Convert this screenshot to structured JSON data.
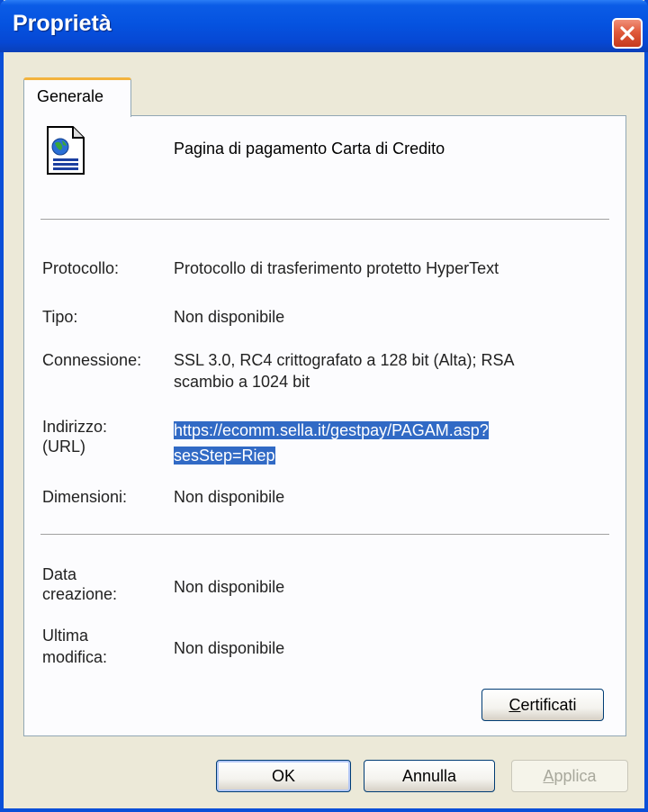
{
  "window": {
    "title": "Proprietà"
  },
  "tabs": [
    {
      "label": "Generale"
    }
  ],
  "page": {
    "title": "Pagina di pagamento Carta di Credito"
  },
  "properties": {
    "protocollo": {
      "label": "Protocollo:",
      "value": "Protocollo di trasferimento protetto HyperText"
    },
    "tipo": {
      "label": "Tipo:",
      "value": "Non disponibile"
    },
    "connessione": {
      "label": "Connessione:",
      "value_line1": "SSL 3.0, RC4 crittografato a 128 bit (Alta); RSA",
      "value_line2": "scambio a 1024 bit"
    },
    "indirizzo": {
      "label_line1": "Indirizzo:",
      "label_line2": "(URL)",
      "value_line1": "https://ecomm.sella.it/gestpay/PAGAM.asp?",
      "value_line2": "sesStep=Riep"
    },
    "dimensioni": {
      "label": "Dimensioni:",
      "value": "Non disponibile"
    },
    "data_creazione": {
      "label_line1": "Data",
      "label_line2": "creazione:",
      "value": "Non disponibile"
    },
    "ultima_modifica": {
      "label_line1": "Ultima",
      "label_line2": "modifica:",
      "value": "Non disponibile"
    }
  },
  "buttons": {
    "certificati": {
      "accel": "C",
      "rest": "ertificati"
    },
    "ok": "OK",
    "annulla": "Annulla",
    "applica": {
      "accel": "A",
      "rest": "pplica"
    }
  },
  "icons": {
    "close": "close-icon",
    "document": "web-document-icon"
  },
  "colors": {
    "titlebar": "#0553e0",
    "selection": "#316ac5",
    "tab_highlight": "#f3b33d",
    "close": "#e05a3c"
  }
}
